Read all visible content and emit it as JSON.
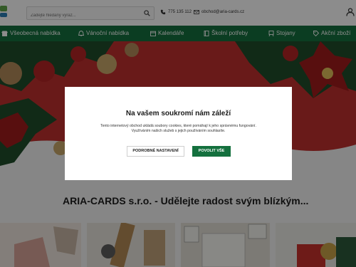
{
  "header": {
    "search_placeholder": "Zadejte hledaný výraz...",
    "phone": "775 135 112",
    "email": "obchod@aria-cards.cz"
  },
  "nav": {
    "items": [
      {
        "label": "Všeobecná nabídka"
      },
      {
        "label": "Vánoční nabídka"
      },
      {
        "label": "Kalendáře"
      },
      {
        "label": "Školní potřeby"
      },
      {
        "label": "Stojany"
      },
      {
        "label": "Akční zboží"
      }
    ]
  },
  "main": {
    "section_title": "ARIA-CARDS s.r.o. - Udělejte radost svým blízkým..."
  },
  "cookie_modal": {
    "title": "Na vašem soukromí nám záleží",
    "text_line1": "Tento internetový obchod ukládá soubory cookies, které pomáhají k jeho správnému fungování.",
    "text_line2": "Využíváním našich služeb s jejich používáním souhlasíte.",
    "settings_label": "PODROBNÉ NASTAVENÍ",
    "accept_label": "POVOLIT VŠE"
  },
  "colors": {
    "brand_green": "#14703e",
    "banner_red": "#c0312e"
  }
}
